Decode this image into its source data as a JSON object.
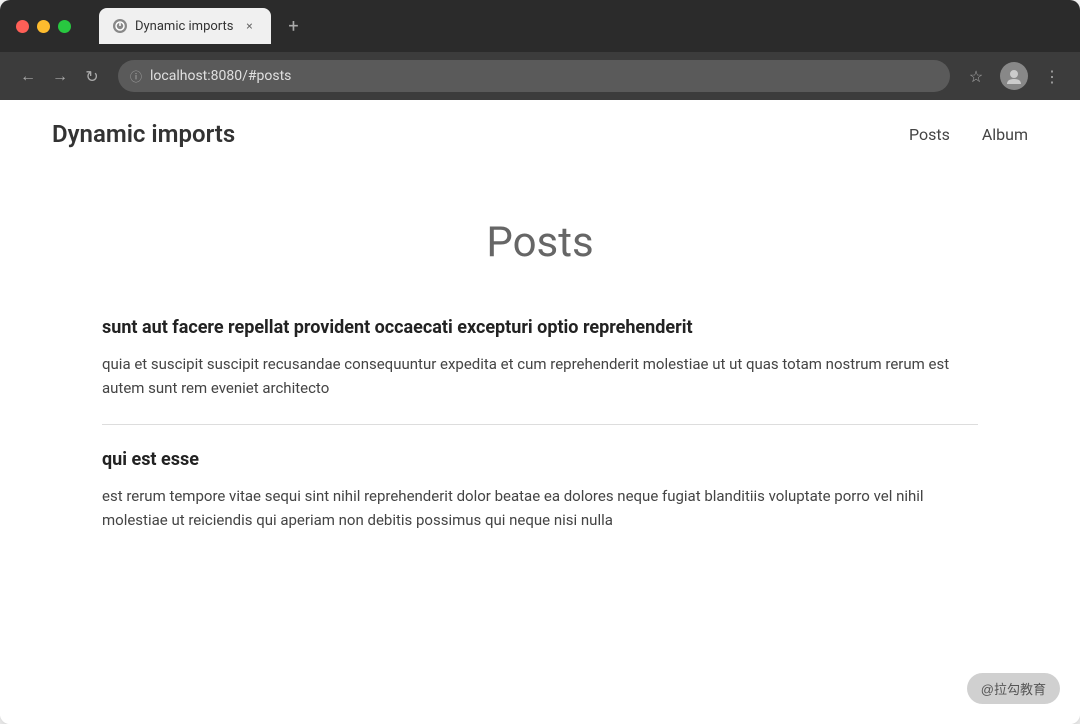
{
  "browser": {
    "tab_title": "Dynamic imports",
    "tab_close": "×",
    "tab_new": "+",
    "url": "localhost:8080/#posts",
    "url_icon": "ⓘ",
    "nav_back": "←",
    "nav_forward": "→",
    "nav_reload": "↻",
    "star_icon": "☆",
    "more_icon": "⋮"
  },
  "app": {
    "title": "Dynamic imports",
    "nav_links": [
      "Posts",
      "Album"
    ]
  },
  "page": {
    "heading": "Posts",
    "posts": [
      {
        "id": 1,
        "title": "sunt aut facere repellat provident occaecati excepturi optio reprehenderit",
        "body": "quia et suscipit suscipit recusandae consequuntur expedita et cum reprehenderit molestiae ut ut quas totam nostrum rerum est autem sunt rem eveniet architecto"
      },
      {
        "id": 2,
        "title": "qui est esse",
        "body": "est rerum tempore vitae sequi sint nihil reprehenderit dolor beatae ea dolores neque fugiat blanditiis voluptate porro vel nihil molestiae ut reiciendis qui aperiam non debitis possimus qui neque nisi nulla"
      },
      {
        "id": 3,
        "title": "",
        "body": ""
      }
    ]
  },
  "watermark": "@拉勾教育"
}
